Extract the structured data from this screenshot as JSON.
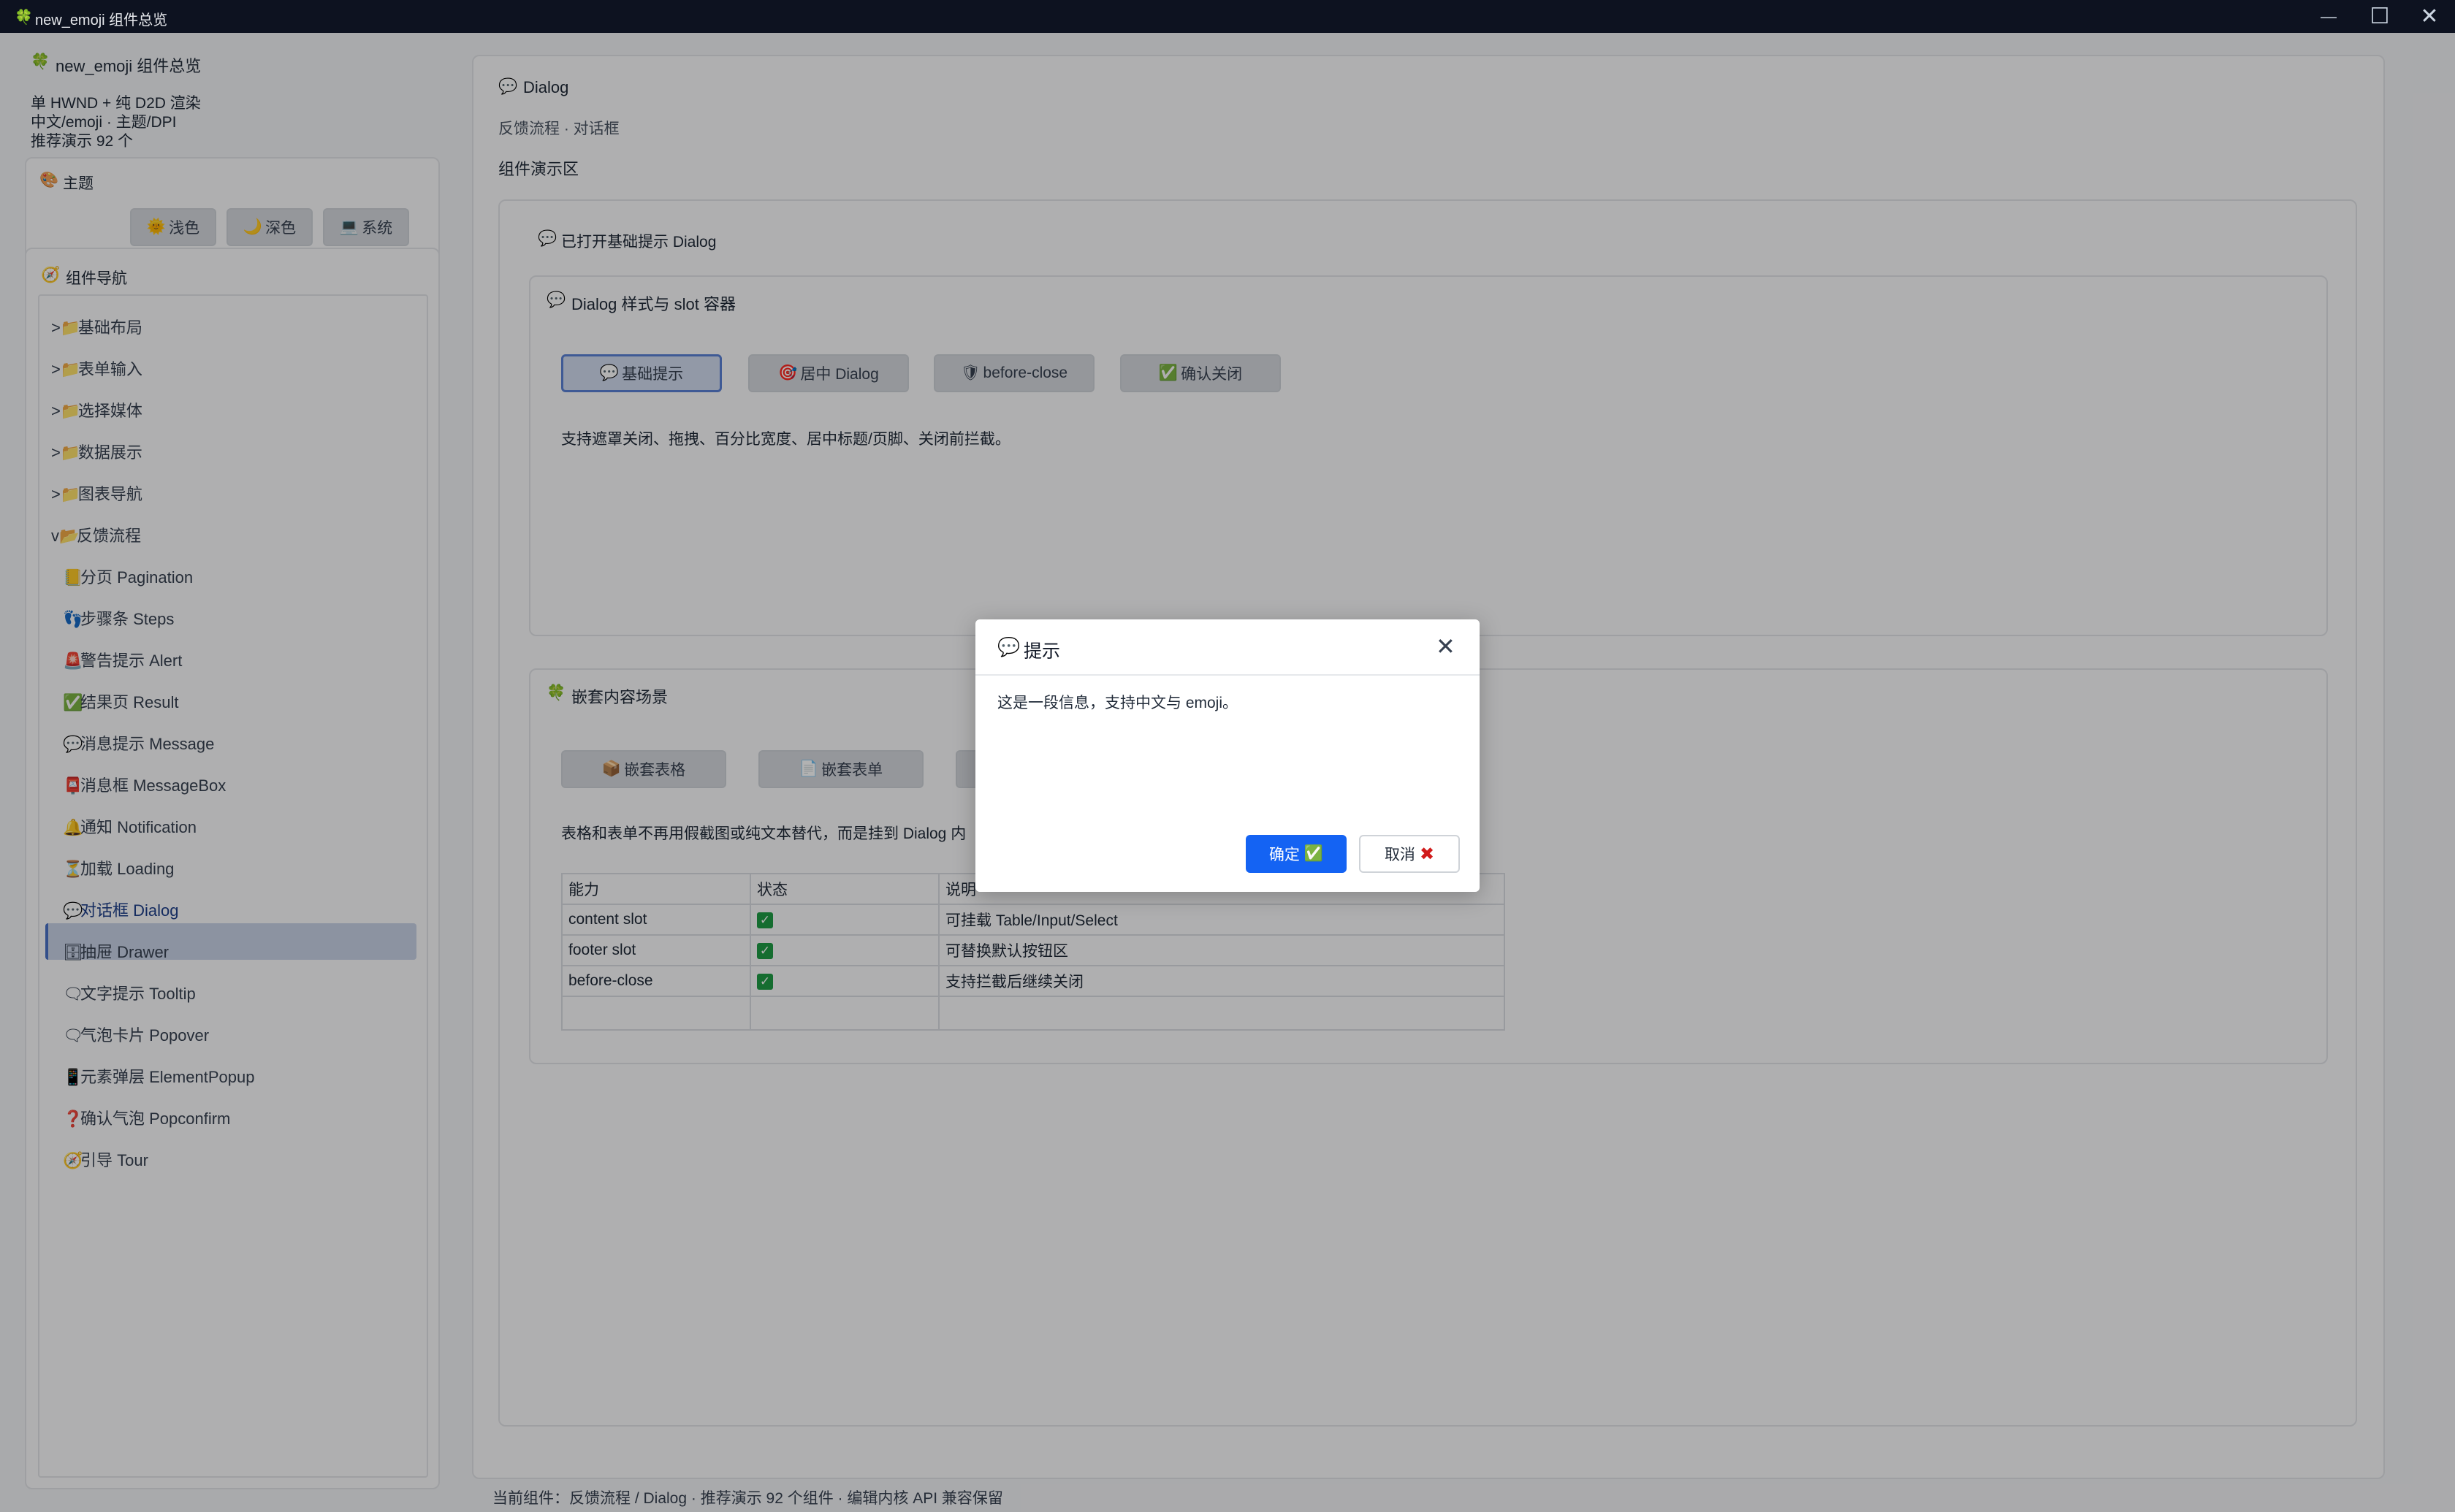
{
  "window": {
    "logo_icon": "🍀",
    "title": "new_emoji 组件总览",
    "minimize": "—",
    "maximize": "☐",
    "close": "✕"
  },
  "sidebar": {
    "app_icon": "🍀",
    "app_title": "new_emoji 组件总览",
    "info": [
      "单 HWND + 纯 D2D 渲染",
      "中文/emoji · 主题/DPI",
      "推荐演示 92 个"
    ],
    "theme": {
      "icon": "🎨",
      "label": "主题",
      "buttons": [
        {
          "icon": "🌞",
          "label": "浅色"
        },
        {
          "icon": "🌙",
          "label": "深色"
        },
        {
          "icon": "💻",
          "label": "系统"
        }
      ]
    },
    "nav": {
      "icon": "🧭",
      "label": "组件导航",
      "groups": [
        {
          "prefix": ">",
          "icon": "📁",
          "label": "基础布局"
        },
        {
          "prefix": ">",
          "icon": "📁",
          "label": "表单输入"
        },
        {
          "prefix": ">",
          "icon": "📁",
          "label": "选择媒体"
        },
        {
          "prefix": ">",
          "icon": "📁",
          "label": "数据展示"
        },
        {
          "prefix": ">",
          "icon": "📁",
          "label": "图表导航"
        },
        {
          "prefix": "v",
          "icon": "📂",
          "label": "反馈流程"
        }
      ],
      "items": [
        {
          "icon": "📒",
          "label": "分页 Pagination"
        },
        {
          "icon": "👣",
          "label": "步骤条 Steps"
        },
        {
          "icon": "🚨",
          "label": "警告提示 Alert"
        },
        {
          "icon": "✅",
          "label": "结果页 Result"
        },
        {
          "icon": "💬",
          "label": "消息提示 Message"
        },
        {
          "icon": "📮",
          "label": "消息框 MessageBox"
        },
        {
          "icon": "🔔",
          "label": "通知 Notification"
        },
        {
          "icon": "⏳",
          "label": "加载 Loading"
        },
        {
          "icon": "💬",
          "label": "对话框 Dialog"
        },
        {
          "icon": "🗄",
          "label": "抽屉 Drawer"
        },
        {
          "icon": "🗨",
          "label": "文字提示 Tooltip"
        },
        {
          "icon": "🗨",
          "label": "气泡卡片 Popover"
        },
        {
          "icon": "📱",
          "label": "元素弹层 ElementPopup"
        },
        {
          "icon": "❓",
          "label": "确认气泡 Popconfirm"
        },
        {
          "icon": "🧭",
          "label": "引导 Tour"
        }
      ]
    }
  },
  "main": {
    "icon": "💬",
    "title": "Dialog",
    "breadcrumb": "反馈流程 · 对话框",
    "demo_area_label": "组件演示区",
    "status_icon": "💬",
    "status_text": "已打开基础提示 Dialog",
    "section1": {
      "icon": "💬",
      "title": "Dialog 样式与 slot 容器",
      "buttons": [
        {
          "icon": "💬",
          "label": "基础提示"
        },
        {
          "icon": "🎯",
          "label": "居中 Dialog"
        },
        {
          "icon": "🛡",
          "label": "before-close"
        },
        {
          "icon": "✅",
          "label": "确认关闭"
        }
      ],
      "desc": "支持遮罩关闭、拖拽、百分比宽度、居中标题/页脚、关闭前拦截。"
    },
    "section2": {
      "icon": "🍀",
      "title": "嵌套内容场景",
      "buttons": [
        {
          "icon": "📦",
          "label": "嵌套表格"
        },
        {
          "icon": "📄",
          "label": "嵌套表单"
        }
      ],
      "desc": "表格和表单不再用假截图或纯文本替代，而是挂到 Dialog 内",
      "table": {
        "headers": [
          "能力",
          "状态",
          "说明"
        ],
        "rows": [
          {
            "cap": "content slot",
            "status": "✓",
            "note": "可挂载 Table/Input/Select"
          },
          {
            "cap": "footer slot",
            "status": "✓",
            "note": "可替换默认按钮区"
          },
          {
            "cap": "before-close",
            "status": "✓",
            "note": "支持拦截后继续关闭"
          }
        ]
      }
    }
  },
  "footer": {
    "text": "当前组件：反馈流程 / Dialog · 推荐演示 92 个组件 · 编辑内核 API 兼容保留"
  },
  "dialog": {
    "icon": "💬",
    "title": "提示",
    "close": "✕",
    "body": "这是一段信息，支持中文与 emoji。",
    "ok_label": "确定",
    "ok_icon": "✅",
    "cancel_label": "取消",
    "cancel_icon": "✖"
  }
}
